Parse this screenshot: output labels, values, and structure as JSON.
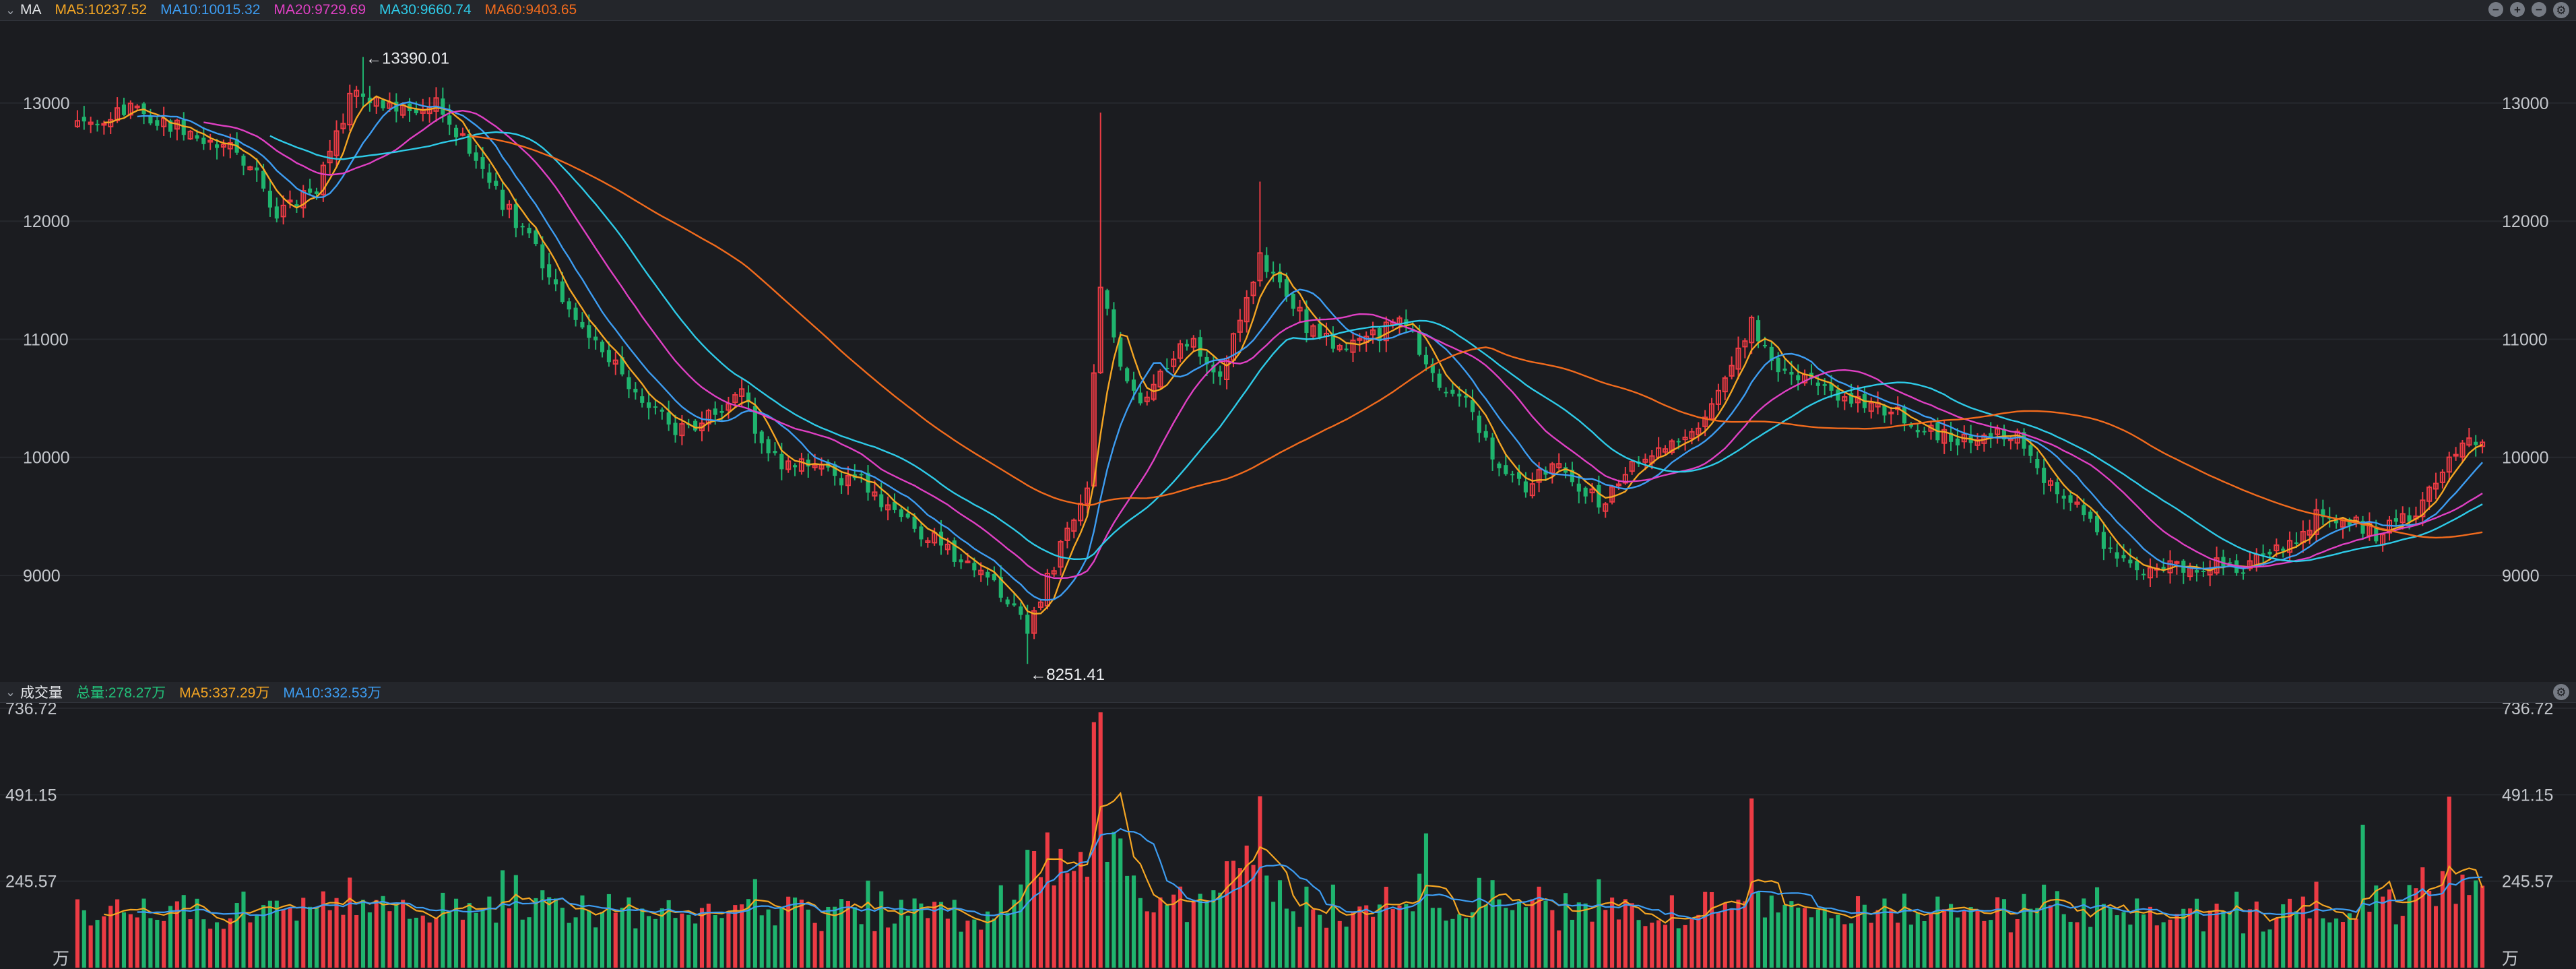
{
  "price_panel": {
    "toggle_icon": "chevron-down-icon",
    "title": "MA",
    "legend": [
      {
        "label": "MA5:10237.52",
        "color": "#f5a623"
      },
      {
        "label": "MA10:10015.32",
        "color": "#3d9df2"
      },
      {
        "label": "MA20:9729.69",
        "color": "#e040c4"
      },
      {
        "label": "MA30:9660.74",
        "color": "#2ecbe8"
      },
      {
        "label": "MA60:9403.65",
        "color": "#f26b1d"
      }
    ],
    "tools": [
      {
        "name": "collapse-icon",
        "glyph": "−"
      },
      {
        "name": "add-indicator-icon",
        "glyph": "+"
      },
      {
        "name": "remove-indicator-icon",
        "glyph": "−"
      },
      {
        "name": "gear-icon",
        "glyph": "⚙"
      }
    ]
  },
  "volume_panel": {
    "toggle_icon": "chevron-down-icon",
    "title": "成交量",
    "legend": [
      {
        "label": "总量:278.27万",
        "color": "#22c27a"
      },
      {
        "label": "MA5:337.29万",
        "color": "#f5a623"
      },
      {
        "label": "MA10:332.53万",
        "color": "#3d9df2"
      }
    ],
    "unit": "万",
    "tools": [
      {
        "name": "gear-icon",
        "glyph": "⚙"
      }
    ]
  },
  "colors": {
    "up": "#ec3b44",
    "down": "#1fb46e",
    "grid": "#26282d",
    "ma5": "#f5a623",
    "ma10": "#3d9df2",
    "ma20": "#e040c4",
    "ma30": "#2ecbe8",
    "ma60": "#f26b1d"
  },
  "chart_data": [
    {
      "type": "candlestick",
      "title": "",
      "y_ticks": [
        "13000",
        "12000",
        "11000",
        "10000",
        "9000"
      ],
      "ylim": [
        8150,
        13650
      ],
      "n_bars": 240,
      "close_anchors": [
        [
          0,
          12850
        ],
        [
          8,
          12950
        ],
        [
          20,
          12700
        ],
        [
          26,
          12500
        ],
        [
          30,
          12050
        ],
        [
          36,
          12300
        ],
        [
          42,
          13150
        ],
        [
          48,
          12900
        ],
        [
          54,
          13050
        ],
        [
          60,
          12500
        ],
        [
          66,
          12000
        ],
        [
          74,
          11300
        ],
        [
          82,
          10700
        ],
        [
          90,
          10200
        ],
        [
          96,
          10400
        ],
        [
          100,
          10550
        ],
        [
          104,
          10000
        ],
        [
          110,
          9900
        ],
        [
          118,
          9800
        ],
        [
          126,
          9400
        ],
        [
          134,
          9100
        ],
        [
          140,
          8800
        ],
        [
          143,
          8500
        ],
        [
          148,
          9250
        ],
        [
          152,
          9800
        ],
        [
          154,
          11500
        ],
        [
          157,
          10700
        ],
        [
          160,
          10400
        ],
        [
          164,
          10800
        ],
        [
          168,
          11000
        ],
        [
          172,
          10650
        ],
        [
          176,
          11300
        ],
        [
          178,
          11700
        ],
        [
          181,
          11500
        ],
        [
          185,
          11100
        ],
        [
          190,
          10950
        ],
        [
          196,
          11050
        ],
        [
          200,
          11150
        ],
        [
          204,
          10700
        ],
        [
          210,
          10400
        ],
        [
          214,
          9900
        ],
        [
          218,
          9700
        ],
        [
          222,
          9950
        ],
        [
          226,
          9750
        ],
        [
          230,
          9600
        ],
        [
          236,
          10050
        ],
        [
          242,
          10150
        ],
        [
          247,
          10500
        ],
        [
          252,
          11150
        ],
        [
          256,
          10750
        ],
        [
          262,
          10600
        ],
        [
          268,
          10450
        ],
        [
          274,
          10350
        ],
        [
          280,
          10200
        ],
        [
          286,
          10100
        ],
        [
          292,
          10250
        ],
        [
          296,
          9800
        ],
        [
          302,
          9500
        ],
        [
          306,
          9150
        ],
        [
          310,
          9050
        ],
        [
          318,
          9050
        ],
        [
          326,
          9100
        ],
        [
          333,
          9300
        ],
        [
          338,
          9550
        ],
        [
          342,
          9450
        ],
        [
          346,
          9350
        ],
        [
          352,
          9550
        ],
        [
          356,
          9900
        ],
        [
          360,
          10200
        ],
        [
          362,
          10150
        ]
      ],
      "annotations": [
        {
          "label": "←13390.01",
          "value": 13390.01
        },
        {
          "label": "←8251.41",
          "value": 8251.41
        }
      ],
      "series": [
        {
          "name": "MA5",
          "period": 5
        },
        {
          "name": "MA10",
          "period": 10
        },
        {
          "name": "MA20",
          "period": 20
        },
        {
          "name": "MA30",
          "period": 30
        },
        {
          "name": "MA60",
          "period": 60
        }
      ]
    },
    {
      "type": "bar",
      "title": "",
      "y_ticks": [
        "736.72",
        "491.15",
        "245.57"
      ],
      "ylim": [
        0,
        736.72
      ],
      "n_bars": 240
    }
  ]
}
